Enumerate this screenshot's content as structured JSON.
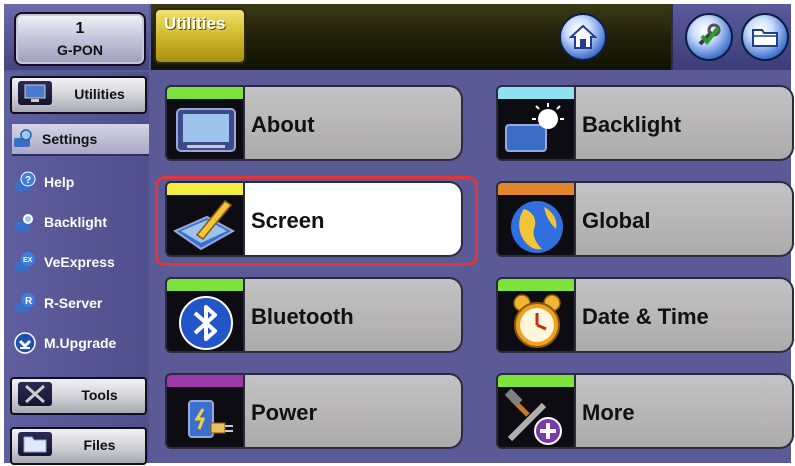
{
  "header": {
    "port_number": "1",
    "port_label": "G-PON",
    "title": "Utilities"
  },
  "sidebar": {
    "utilities_button": "Utilities",
    "items": [
      {
        "label": "Settings",
        "icon": "settings-icon",
        "active": true
      },
      {
        "label": "Help",
        "icon": "help-icon",
        "active": false
      },
      {
        "label": "Backlight",
        "icon": "backlight-icon",
        "active": false
      },
      {
        "label": "VeExpress",
        "icon": "veexpress-icon",
        "active": false
      },
      {
        "label": "R-Server",
        "icon": "r-server-icon",
        "active": false
      },
      {
        "label": "M.Upgrade",
        "icon": "upgrade-icon",
        "active": false
      }
    ],
    "tools_button": "Tools",
    "files_button": "Files"
  },
  "tiles": [
    {
      "label": "About",
      "strip_color": "#7ee23c",
      "icon": "device-icon",
      "selected": false
    },
    {
      "label": "Backlight",
      "strip_color": "#8fe0f0",
      "icon": "backlight-icon",
      "selected": false
    },
    {
      "label": "Screen",
      "strip_color": "#f2ee40",
      "icon": "screen-pen-icon",
      "selected": true
    },
    {
      "label": "Global",
      "strip_color": "#e0852b",
      "icon": "globe-icon",
      "selected": false
    },
    {
      "label": "Bluetooth",
      "strip_color": "#7ee23c",
      "icon": "bluetooth-icon",
      "selected": false
    },
    {
      "label": "Date & Time",
      "strip_color": "#7ee23c",
      "icon": "alarm-clock-icon",
      "selected": false
    },
    {
      "label": "Power",
      "strip_color": "#9b39a8",
      "icon": "power-plug-icon",
      "selected": false
    },
    {
      "label": "More",
      "strip_color": "#7ee23c",
      "icon": "tools-plus-icon",
      "selected": false
    }
  ],
  "colors": {
    "frame": "#5a5a96",
    "selection_ring": "#e0353a",
    "title_tab": "#d8c237"
  }
}
